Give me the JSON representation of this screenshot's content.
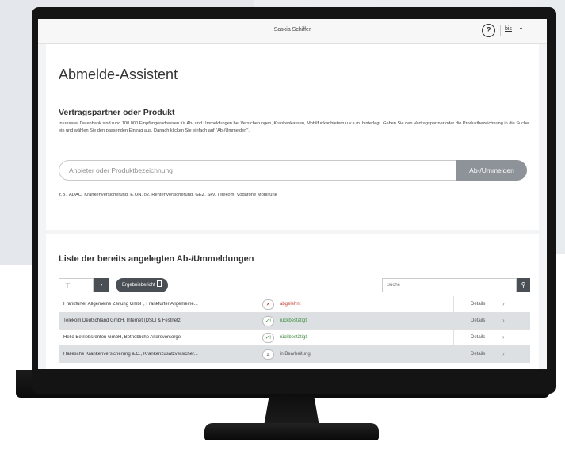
{
  "header": {
    "user_name": "Saskia Schiffer",
    "help_glyph": "?",
    "lang_label": "bis",
    "caret_glyph": "▾"
  },
  "page": {
    "title": "Abmelde-Assistent"
  },
  "search_section": {
    "title": "Vertragspartner oder Produkt",
    "description": "In unserer Datenbank sind rund 100.000 Empfängeradressen für Ab- und Ummeldungen bei Versicherungen, Krankenkassen, Mobilfunkanbietern u.v.a.m. hinterlegt. Geben Sie den Vertragspartner oder die Produktbezeichnung in die Suche ein und wählen Sie den passenden Eintrag aus. Danach klicken Sie einfach auf \"Ab-/Ummelden\".",
    "placeholder": "Anbieter oder Produktbezeichnung",
    "submit_label": "Ab-/Ummelden",
    "examples": "z.B.: ADAC, Krankenversicherung, E.ON, o2, Rentenversicherung, GEZ, Sky, Telekom, Vodafone Mobilfunk"
  },
  "list_section": {
    "title": "Liste der bereits angelegten Ab-/Ummeldungen",
    "filter_glyph": "⊤",
    "filter_caret": "▾",
    "report_label": "Ergebnisbericht",
    "search_placeholder": "Suche",
    "search_glyph": "⚲",
    "rows": [
      {
        "name": "Frankfurter Allgemeine Zeitung GmbH, Frankfurter Allgemeine...",
        "status_glyph": "✕",
        "status": "abgelehnt",
        "details": "Details",
        "chev": "›"
      },
      {
        "name": "Telekom Deutschland GmbH, Internet (DSL) & Festnetz",
        "status_glyph": "✓!",
        "status": "rückbestätigt",
        "details": "Details",
        "chev": "›"
      },
      {
        "name": "Hello Betriebsrenten GmbH, Betriebliche Altersvorsorge",
        "status_glyph": "✓!",
        "status": "rückbestätigt",
        "details": "Details",
        "chev": "›"
      },
      {
        "name": "Hallesche Krankenversicherung a.G., Krankenzusatzversicher...",
        "status_glyph": "⧖",
        "status": "in Bearbeitung",
        "details": "Details",
        "chev": "›"
      }
    ]
  },
  "colors": {
    "rejected": "#c0392b",
    "confirmed": "#3c8b3c",
    "button_dark": "#4a4f55",
    "button_grey": "#8d9399"
  }
}
